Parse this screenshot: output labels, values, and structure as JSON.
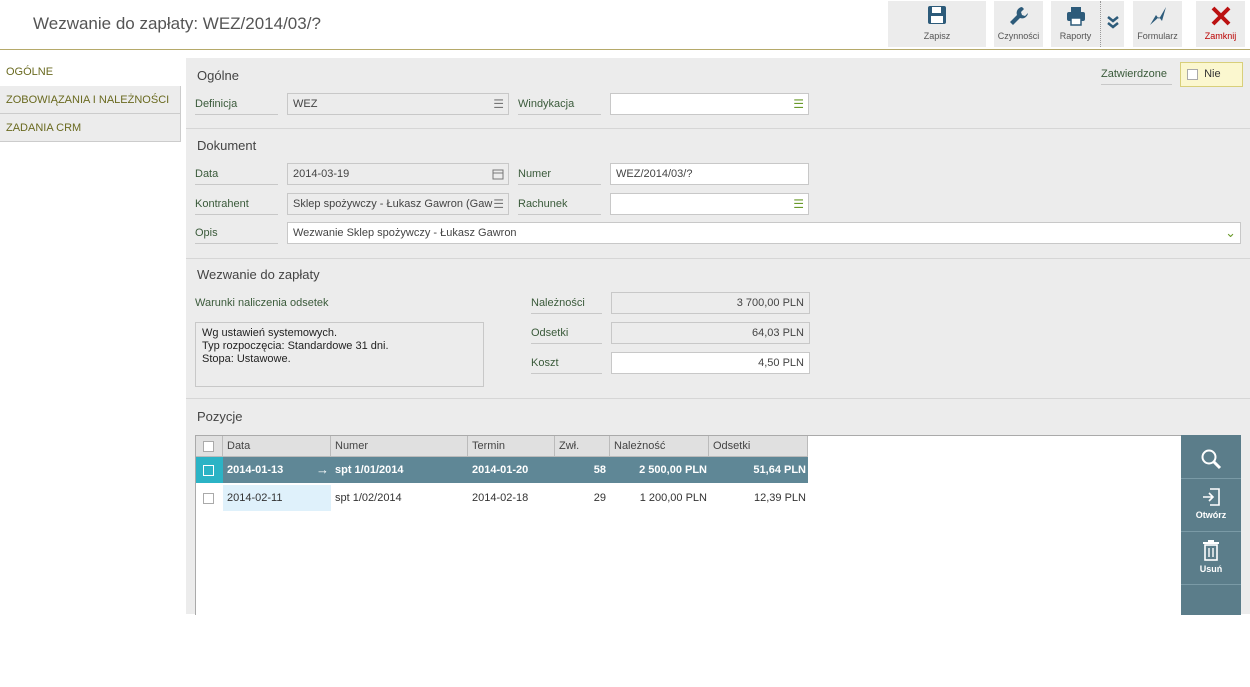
{
  "window": {
    "title": "Wezwanie do zapłaty: WEZ/2014/03/?"
  },
  "toolbar": {
    "save": "Zapisz",
    "actions": "Czynności",
    "reports": "Raporty",
    "form": "Formularz",
    "close": "Zamknij"
  },
  "sidebar": {
    "items": [
      {
        "label": "OGÓLNE"
      },
      {
        "label": "ZOBOWIĄZANIA I NALEŻNOŚCI"
      },
      {
        "label": "ZADANIA CRM"
      }
    ]
  },
  "general": {
    "title": "Ogólne",
    "definition_label": "Definicja",
    "definition_value": "WEZ",
    "collection_label": "Windykacja",
    "collection_value": "",
    "approved_label": "Zatwierdzone",
    "approved_value": "Nie"
  },
  "document": {
    "title": "Dokument",
    "date_label": "Data",
    "date_value": "2014-03-19",
    "number_label": "Numer",
    "number_value": "WEZ/2014/03/?",
    "contractor_label": "Kontrahent",
    "contractor_value": "Sklep spożywczy - Łukasz Gawron (Gaw",
    "account_label": "Rachunek",
    "account_value": "",
    "description_label": "Opis",
    "description_value": "Wezwanie Sklep spożywczy - Łukasz Gawron"
  },
  "demand": {
    "title": "Wezwanie do zapłaty",
    "interest_terms_label": "Warunki naliczenia odsetek",
    "interest_terms_lines": [
      "Wg ustawień systemowych.",
      "Typ rozpoczęcia: Standardowe 31 dni.",
      "Stopa: Ustawowe."
    ],
    "receivables_label": "Należności",
    "receivables_value": "3 700,00 PLN",
    "interest_label": "Odsetki",
    "interest_value": "64,03 PLN",
    "cost_label": "Koszt",
    "cost_value": "4,50 PLN"
  },
  "positions": {
    "title": "Pozycje",
    "columns": [
      "Data",
      "Numer",
      "Termin",
      "Zwł.",
      "Należność",
      "Odsetki"
    ],
    "rows": [
      {
        "date": "2014-01-13",
        "number": "spt 1/01/2014",
        "due": "2014-01-20",
        "delay": "58",
        "amount": "2 500,00 PLN",
        "interest": "51,64 PLN"
      },
      {
        "date": "2014-02-11",
        "number": "spt 1/02/2014",
        "due": "2014-02-18",
        "delay": "29",
        "amount": "1 200,00 PLN",
        "interest": "12,39 PLN"
      }
    ],
    "open_label": "Otwórz",
    "delete_label": "Usuń"
  }
}
